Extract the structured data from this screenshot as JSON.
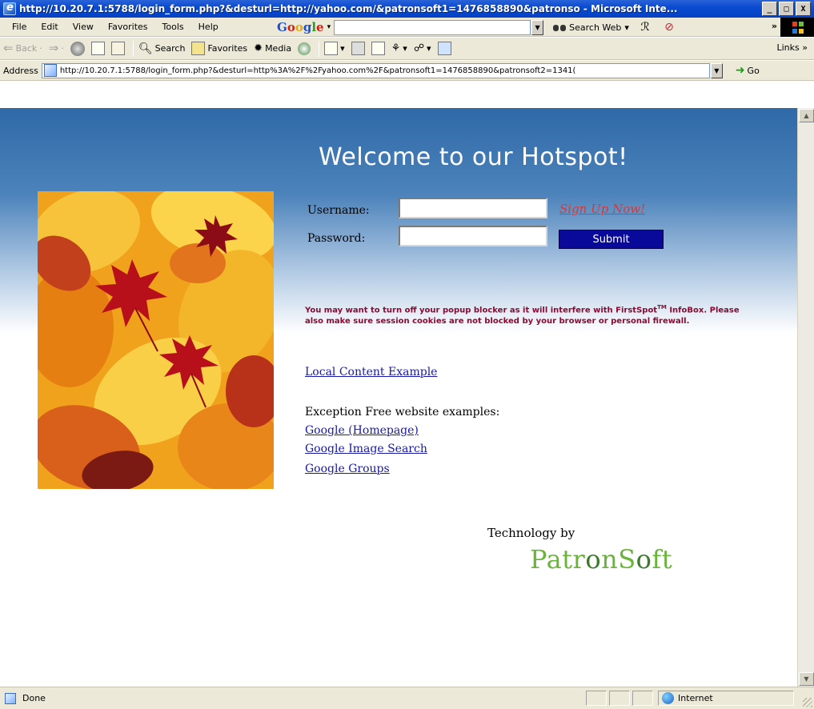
{
  "window": {
    "title": "http://10.20.7.1:5788/login_form.php?&desturl=http://yahoo.com/&patronsoft1=1476858890&patronso - Microsoft Inte...",
    "min_label": "_",
    "max_label": "□",
    "close_label": "X"
  },
  "menu": {
    "items": [
      "File",
      "Edit",
      "View",
      "Favorites",
      "Tools",
      "Help"
    ]
  },
  "google_toolbar": {
    "logo": [
      "G",
      "o",
      "o",
      "g",
      "l",
      "e"
    ],
    "search_web_label": "Search Web",
    "chevron": "»"
  },
  "toolbar": {
    "back_label": "Back",
    "search_label": "Search",
    "favorites_label": "Favorites",
    "media_label": "Media",
    "links_label": "Links"
  },
  "address": {
    "label": "Address",
    "url": "http://10.20.7.1:5788/login_form.php?&desturl=http%3A%2F%2Fyahoo.com%2F&patronsoft1=1476858890&patronsoft2=1341(",
    "go_label": "Go"
  },
  "page": {
    "heading": "Welcome to our Hotspot!",
    "username_label": "Username:",
    "password_label": "Password:",
    "signup_link": "Sign Up Now!",
    "submit_label": "Submit",
    "notice_text": "You may want to turn off your popup blocker as it will interfere with FirstSpot",
    "notice_tm": "TM",
    "notice_text2": " InfoBox. Please also make sure session cookies are not blocked by your browser or personal firewall.",
    "local_content_link": "Local Content Example",
    "exception_heading": "Exception Free website examples:",
    "example_links": [
      "Google (Homepage)",
      "Google Image Search",
      "Google Groups"
    ],
    "tech_by": "Technology by",
    "brand_prefix": "Patr",
    "brand_o1": "o",
    "brand_mid": "nS",
    "brand_o2": "o",
    "brand_suffix": "ft"
  },
  "status": {
    "text": "Done",
    "zone": "Internet"
  },
  "colors": {
    "heading": "#ffffff",
    "signup": "#d83838",
    "submit_bg": "#0a0a9a",
    "notice": "#8b0a32",
    "link": "#1818a8",
    "brand": "#6ab43a"
  }
}
